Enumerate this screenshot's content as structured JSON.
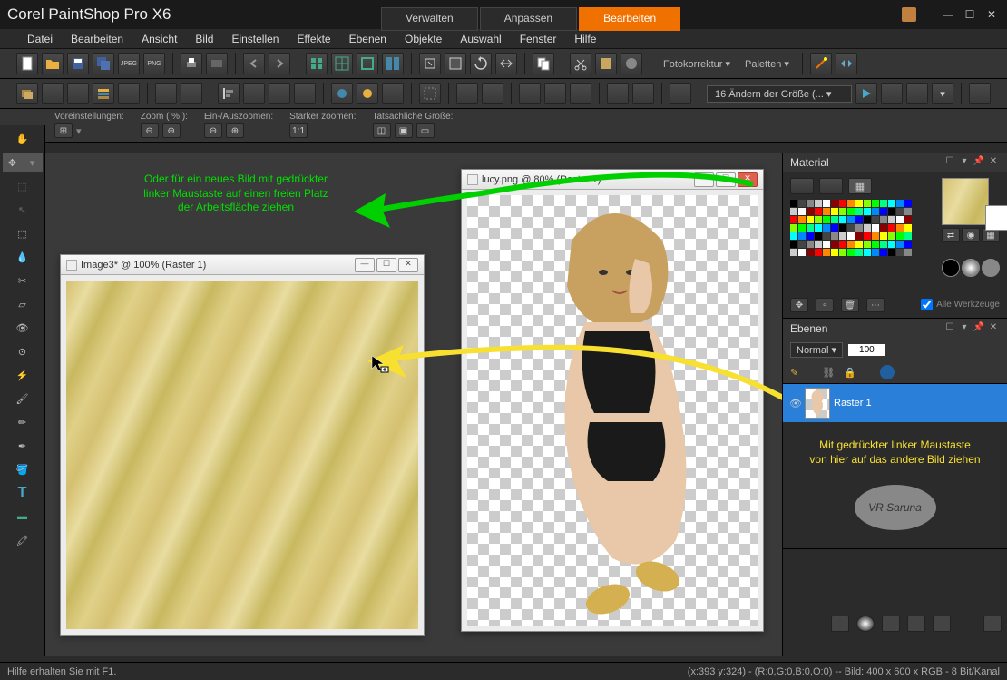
{
  "app_title": "Corel PaintShop Pro X6",
  "tabs": {
    "verwalten": "Verwalten",
    "anpassen": "Anpassen",
    "bearbeiten": "Bearbeiten"
  },
  "menu": [
    "Datei",
    "Bearbeiten",
    "Ansicht",
    "Bild",
    "Einstellen",
    "Effekte",
    "Ebenen",
    "Objekte",
    "Auswahl",
    "Fenster",
    "Hilfe"
  ],
  "toolbar_labels": {
    "foto": "Fotokorrektur",
    "paletten": "Paletten",
    "dropdown": "16 Ändern der Größe (..."
  },
  "options": {
    "voreinst": "Voreinstellungen:",
    "zoom": "Zoom  ( % ):",
    "ein_aus": "Ein-/Auszoomen:",
    "stark": "Stärker zoomen:",
    "tats": "Tatsächliche Größe:"
  },
  "windows": {
    "image3": "Image3* @ 100% (Raster 1)",
    "lucy": "lucy.png @  80% (Raster 1)"
  },
  "annotations": {
    "green1": "Oder für ein neues Bild mit gedrückter",
    "green2": "linker Maustaste auf einen freien Platz",
    "green3": "der Arbeitsfläche ziehen",
    "yellow1": "Mit gedrückter linker Maustaste",
    "yellow2": "von hier auf das andere Bild ziehen"
  },
  "panels": {
    "material": "Material",
    "ebenen": "Ebenen",
    "blend": "Normal",
    "opacity": "100",
    "layer_name": "Raster 1",
    "alle_werkz": "Alle Werkzeuge"
  },
  "status": {
    "help": "Hilfe erhalten Sie mit F1.",
    "info": "(x:393 y:324) - (R:0,G:0,B:0,O:0) -- Bild:   400 x 600 x RGB - 8 Bit/Kanal"
  },
  "watermark": "VR Saruna"
}
